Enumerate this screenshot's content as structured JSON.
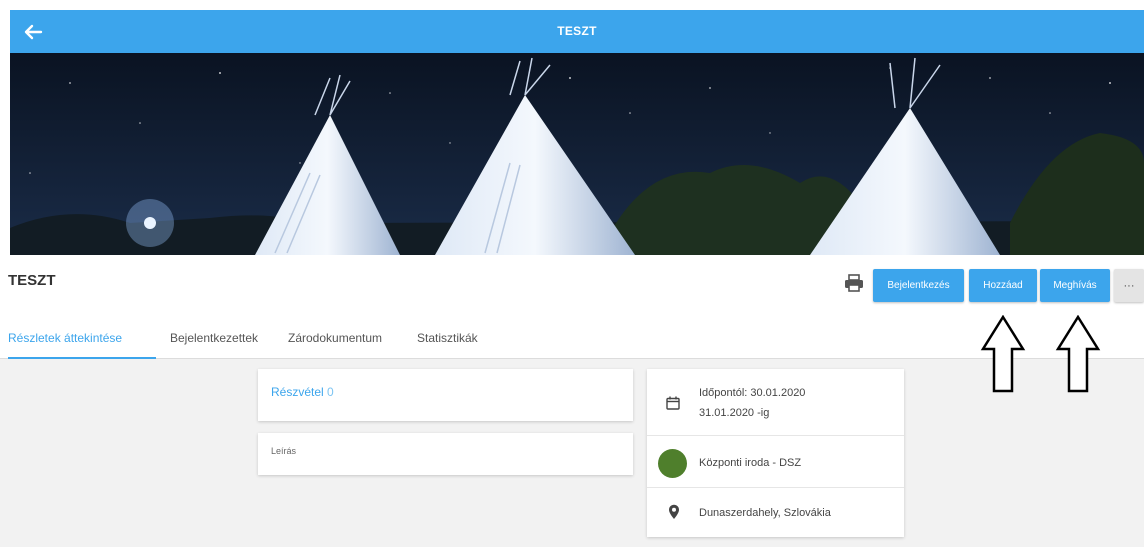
{
  "appbar": {
    "title": "TESZT",
    "back_icon": "arrow-left-icon",
    "color": "#3ca5ec"
  },
  "cover": {
    "alt": "teepee tents under a starry night sky"
  },
  "event": {
    "title": "TESZT"
  },
  "toolbar": {
    "print_icon": "printer-icon",
    "checkin_label": "Bejelentkezés",
    "add_label": "Hozzáad",
    "invite_label": "Meghívás",
    "more_label": "···"
  },
  "tabs": [
    {
      "label": "Részletek áttekintése",
      "active": true
    },
    {
      "label": "Bejelentkezettek",
      "active": false
    },
    {
      "label": "Zárodokumentum",
      "active": false
    },
    {
      "label": "Statisztikák",
      "active": false
    }
  ],
  "participation": {
    "label": "Részvétel",
    "count": "0"
  },
  "description": {
    "label": "Leírás"
  },
  "info": {
    "date_from": "Időpontól: 30.01.2020",
    "date_to": "31.01.2020 -ig",
    "organizer": "Központi iroda - DSZ",
    "organizer_color": "#4f7f2c",
    "location": "Dunaszerdahely, Szlovákia"
  }
}
